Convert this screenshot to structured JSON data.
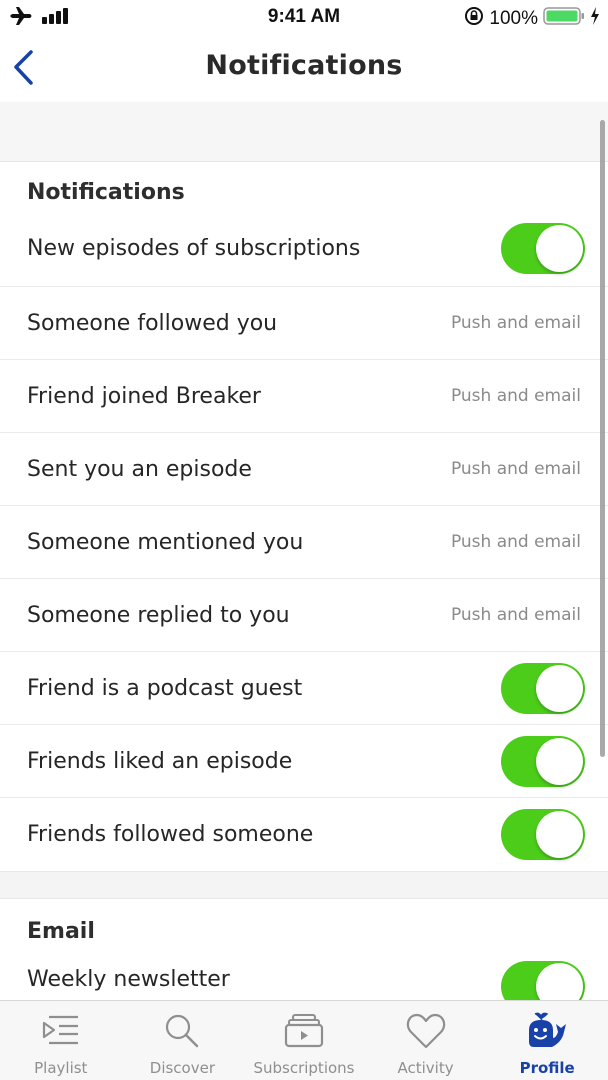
{
  "status_bar": {
    "time": "9:41 AM",
    "battery_percent": "100%",
    "icons": [
      "airplane-icon",
      "signal-icon",
      "rotation-lock-icon",
      "battery-icon",
      "charging-icon"
    ]
  },
  "nav": {
    "title": "Notifications",
    "back_icon": "chevron-left-icon"
  },
  "colors": {
    "accent": "#1842a8",
    "toggle_on": "#4ccd1a",
    "secondary_text": "#8a8a8a"
  },
  "sections": [
    {
      "header": "Notifications",
      "rows": [
        {
          "label": "New episodes of subscriptions",
          "type": "toggle",
          "on": true
        },
        {
          "label": "Someone followed you",
          "type": "value",
          "value": "Push and email"
        },
        {
          "label": "Friend joined Breaker",
          "type": "value",
          "value": "Push and email"
        },
        {
          "label": "Sent you an episode",
          "type": "value",
          "value": "Push and email"
        },
        {
          "label": "Someone mentioned you",
          "type": "value",
          "value": "Push and email"
        },
        {
          "label": "Someone replied to you",
          "type": "value",
          "value": "Push and email"
        },
        {
          "label": "Friend is a podcast guest",
          "type": "toggle",
          "on": true
        },
        {
          "label": "Friends liked an episode",
          "type": "toggle",
          "on": true
        },
        {
          "label": "Friends followed someone",
          "type": "toggle",
          "on": true
        }
      ]
    },
    {
      "header": "Email",
      "rows": [
        {
          "label": "Weekly newsletter",
          "type": "toggle",
          "on": true
        }
      ]
    }
  ],
  "tabs": [
    {
      "label": "Playlist",
      "icon": "playlist-icon",
      "active": false
    },
    {
      "label": "Discover",
      "icon": "search-icon",
      "active": false
    },
    {
      "label": "Subscriptions",
      "icon": "subscriptions-icon",
      "active": false
    },
    {
      "label": "Activity",
      "icon": "heart-icon",
      "active": false
    },
    {
      "label": "Profile",
      "icon": "whale-icon",
      "active": true
    }
  ]
}
